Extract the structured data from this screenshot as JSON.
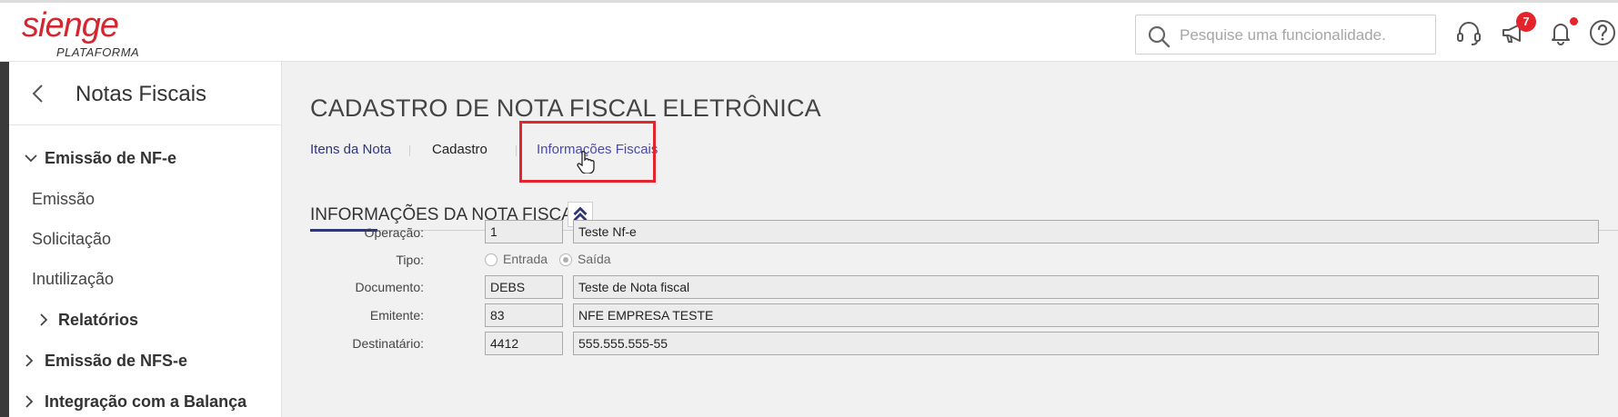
{
  "header": {
    "logo_main": "sienge",
    "logo_sub": "PLATAFORMA",
    "search_placeholder": "Pesquise uma funcionalidade.",
    "announcements_badge": "7",
    "accent_color": "#d5262f"
  },
  "sidebar": {
    "title": "Notas Fiscais",
    "items": [
      {
        "label": "Emissão de NF-e",
        "expanded": true
      },
      {
        "label": "Emissão"
      },
      {
        "label": "Solicitação"
      },
      {
        "label": "Inutilização"
      },
      {
        "label": "Relatórios",
        "expanded": false
      },
      {
        "label": "Emissão de NFS-e",
        "expanded": false
      },
      {
        "label": "Integração com a Balança",
        "expanded": false
      }
    ]
  },
  "main": {
    "page_title": "CADASTRO DE NOTA FISCAL ELETRÔNICA",
    "tabs": [
      {
        "label": "Itens da Nota",
        "color": "#2f3579"
      },
      {
        "label": "Cadastro",
        "color": "#222222",
        "active": true
      },
      {
        "label": "Informações Fiscais",
        "color": "#4a4aa8",
        "highlighted": true
      }
    ],
    "section_title": "INFORMAÇÕES DA NOTA FISCAL",
    "form": {
      "operacao": {
        "label": "Operação:",
        "code": "1",
        "desc": "Teste Nf-e"
      },
      "tipo": {
        "label": "Tipo:",
        "option_entrada": "Entrada",
        "option_saida": "Saída",
        "selected": "Saída"
      },
      "documento": {
        "label": "Documento:",
        "code": "DEBS",
        "desc": "Teste de Nota fiscal"
      },
      "emitente": {
        "label": "Emitente:",
        "code": "83",
        "desc": "NFE EMPRESA TESTE"
      },
      "destinatario": {
        "label": "Destinatário:",
        "code": "4412",
        "desc": "555.555.555-55"
      }
    }
  }
}
